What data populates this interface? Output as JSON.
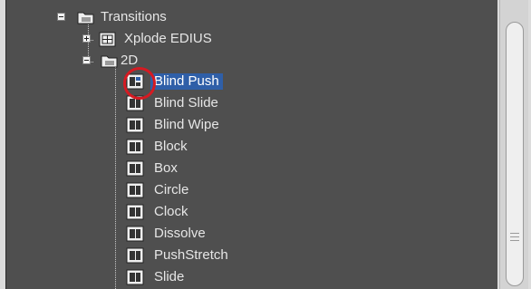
{
  "tree": {
    "items": [
      {
        "label": "Transitions",
        "expander": "minus",
        "icon": "folder-icon"
      },
      {
        "label": "Xplode EDIUS",
        "expander": "plus",
        "icon": "effect-group-icon"
      },
      {
        "label": "2D",
        "expander": "minus",
        "icon": "folder-icon"
      },
      {
        "label": "Blind Push",
        "icon": "transition-icon",
        "selected": true
      },
      {
        "label": "Blind Slide",
        "icon": "transition-icon"
      },
      {
        "label": "Blind Wipe",
        "icon": "transition-icon"
      },
      {
        "label": "Block",
        "icon": "transition-icon"
      },
      {
        "label": "Box",
        "icon": "transition-icon"
      },
      {
        "label": "Circle",
        "icon": "transition-icon"
      },
      {
        "label": "Clock",
        "icon": "transition-icon"
      },
      {
        "label": "Dissolve",
        "icon": "transition-icon"
      },
      {
        "label": "PushStretch",
        "icon": "transition-icon"
      },
      {
        "label": "Slide",
        "icon": "transition-icon"
      }
    ]
  },
  "colors": {
    "panel_bg": "#4f4f4f",
    "selection": "#2f5fa8",
    "highlight": "#d61a22"
  }
}
